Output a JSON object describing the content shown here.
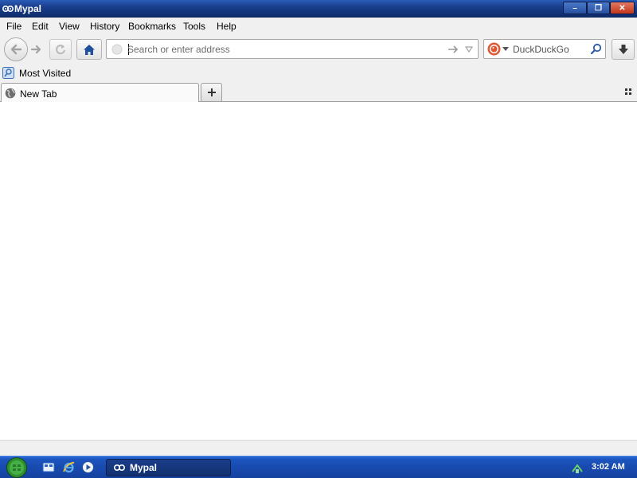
{
  "window": {
    "title": "Mypal",
    "controls": {
      "minimize": "–",
      "maximize": "❐",
      "close": "✕"
    }
  },
  "menu": {
    "items": [
      {
        "label": "File"
      },
      {
        "label": "Edit"
      },
      {
        "label": "View"
      },
      {
        "label": "History"
      },
      {
        "label": "Bookmarks"
      },
      {
        "label": "Tools"
      },
      {
        "label": "Help"
      }
    ]
  },
  "navbar": {
    "url_placeholder": "Search or enter address",
    "url_value": "",
    "search_engine": "DuckDuckGo",
    "search_placeholder": "DuckDuckGo",
    "search_value": ""
  },
  "bookmarks": {
    "items": [
      {
        "label": "Most Visited",
        "icon": "most-visited-icon"
      }
    ]
  },
  "tabs": {
    "items": [
      {
        "label": "New Tab",
        "icon": "globe-icon",
        "active": true
      }
    ],
    "new_tab_label": "+"
  },
  "taskbar": {
    "quick_launch": [
      "desktop-icon",
      "internet-explorer-icon",
      "media-player-icon"
    ],
    "tasks": [
      {
        "label": "Mypal",
        "icon": "mypal-icon"
      }
    ],
    "clock": "3:02 AM"
  },
  "colors": {
    "titlebar": "#1a3f8e",
    "chrome": "#f0f0f0",
    "taskbar": "#184aae",
    "home_blue": "#1f4f9f",
    "close_red": "#c2361c"
  }
}
